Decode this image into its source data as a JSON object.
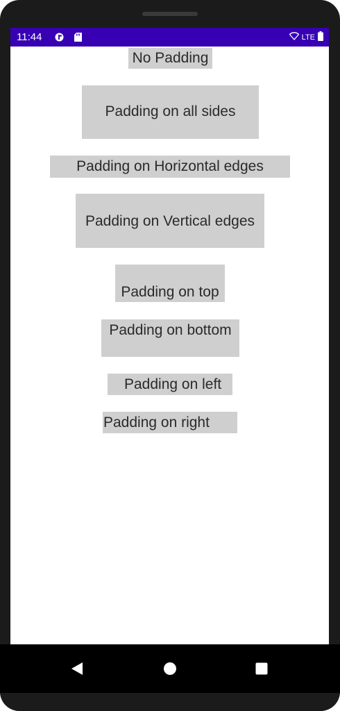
{
  "status_bar": {
    "time": "11:44",
    "network_label": "LTE",
    "color": "#3700b3"
  },
  "padding_labels": {
    "no_padding": "No Padding",
    "all_sides": "Padding on all sides",
    "horizontal": "Padding on Horizontal edges",
    "vertical": "Padding on Vertical edges",
    "top": "Padding on top",
    "bottom": "Padding on bottom",
    "left": "Padding on left",
    "right": "Padding on right"
  },
  "label_background": "#cfcfcf",
  "nav_bar": {
    "back": "back-icon",
    "home": "home-icon",
    "recents": "recents-icon"
  }
}
